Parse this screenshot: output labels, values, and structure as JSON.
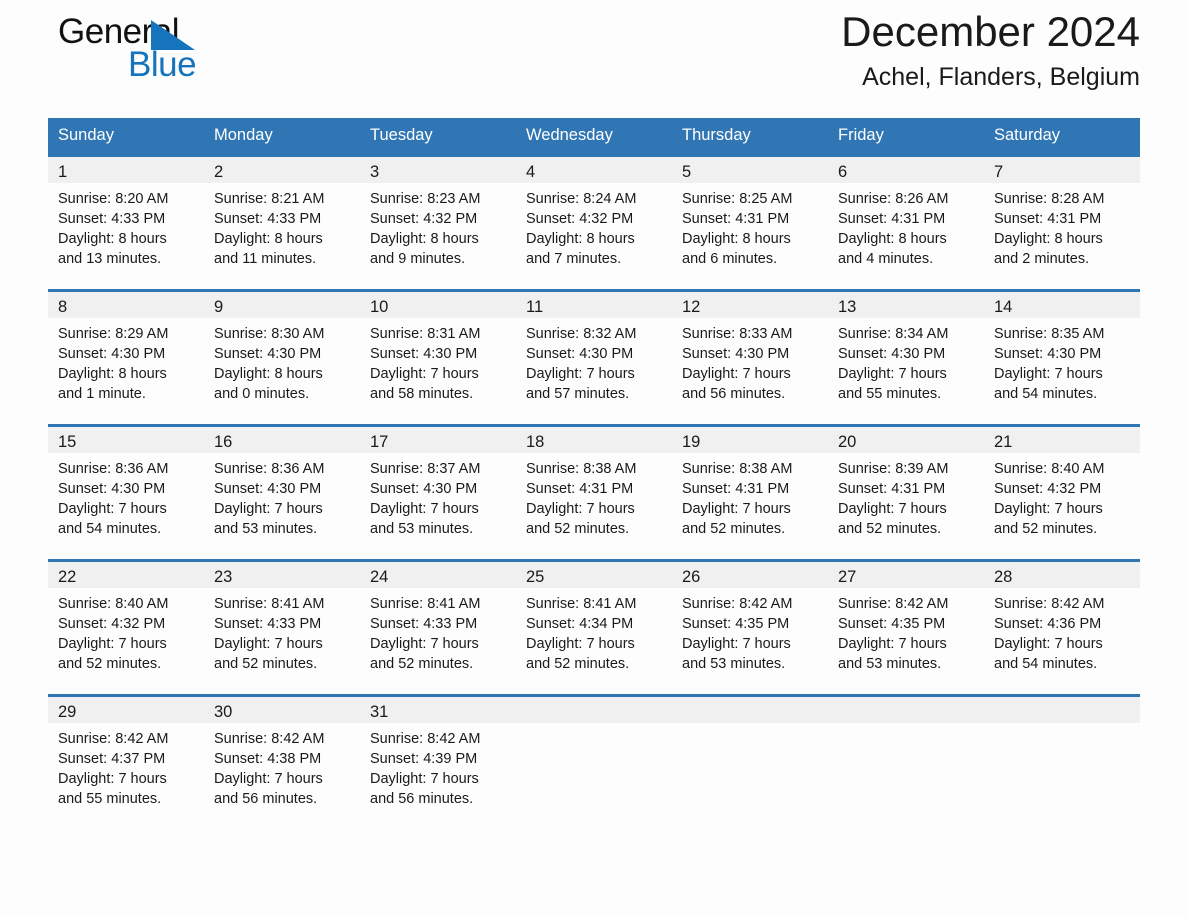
{
  "brand": {
    "name_part1": "General",
    "name_part2": "Blue",
    "triangle_color": "#1574bb",
    "text_color": "#111111"
  },
  "header": {
    "title": "December 2024",
    "subtitle": "Achel, Flanders, Belgium"
  },
  "theme": {
    "accent": "#3075b4",
    "band": "#f0f0f0",
    "page_bg": "#fdfdfd",
    "text": "#1a1a1a"
  },
  "calendar": {
    "weekday_headers": [
      "Sunday",
      "Monday",
      "Tuesday",
      "Wednesday",
      "Thursday",
      "Friday",
      "Saturday"
    ],
    "weeks": [
      [
        {
          "day": "1",
          "sunrise": "Sunrise: 8:20 AM",
          "sunset": "Sunset: 4:33 PM",
          "daylight_line1": "Daylight: 8 hours",
          "daylight_line2": "and 13 minutes."
        },
        {
          "day": "2",
          "sunrise": "Sunrise: 8:21 AM",
          "sunset": "Sunset: 4:33 PM",
          "daylight_line1": "Daylight: 8 hours",
          "daylight_line2": "and 11 minutes."
        },
        {
          "day": "3",
          "sunrise": "Sunrise: 8:23 AM",
          "sunset": "Sunset: 4:32 PM",
          "daylight_line1": "Daylight: 8 hours",
          "daylight_line2": "and 9 minutes."
        },
        {
          "day": "4",
          "sunrise": "Sunrise: 8:24 AM",
          "sunset": "Sunset: 4:32 PM",
          "daylight_line1": "Daylight: 8 hours",
          "daylight_line2": "and 7 minutes."
        },
        {
          "day": "5",
          "sunrise": "Sunrise: 8:25 AM",
          "sunset": "Sunset: 4:31 PM",
          "daylight_line1": "Daylight: 8 hours",
          "daylight_line2": "and 6 minutes."
        },
        {
          "day": "6",
          "sunrise": "Sunrise: 8:26 AM",
          "sunset": "Sunset: 4:31 PM",
          "daylight_line1": "Daylight: 8 hours",
          "daylight_line2": "and 4 minutes."
        },
        {
          "day": "7",
          "sunrise": "Sunrise: 8:28 AM",
          "sunset": "Sunset: 4:31 PM",
          "daylight_line1": "Daylight: 8 hours",
          "daylight_line2": "and 2 minutes."
        }
      ],
      [
        {
          "day": "8",
          "sunrise": "Sunrise: 8:29 AM",
          "sunset": "Sunset: 4:30 PM",
          "daylight_line1": "Daylight: 8 hours",
          "daylight_line2": "and 1 minute."
        },
        {
          "day": "9",
          "sunrise": "Sunrise: 8:30 AM",
          "sunset": "Sunset: 4:30 PM",
          "daylight_line1": "Daylight: 8 hours",
          "daylight_line2": "and 0 minutes."
        },
        {
          "day": "10",
          "sunrise": "Sunrise: 8:31 AM",
          "sunset": "Sunset: 4:30 PM",
          "daylight_line1": "Daylight: 7 hours",
          "daylight_line2": "and 58 minutes."
        },
        {
          "day": "11",
          "sunrise": "Sunrise: 8:32 AM",
          "sunset": "Sunset: 4:30 PM",
          "daylight_line1": "Daylight: 7 hours",
          "daylight_line2": "and 57 minutes."
        },
        {
          "day": "12",
          "sunrise": "Sunrise: 8:33 AM",
          "sunset": "Sunset: 4:30 PM",
          "daylight_line1": "Daylight: 7 hours",
          "daylight_line2": "and 56 minutes."
        },
        {
          "day": "13",
          "sunrise": "Sunrise: 8:34 AM",
          "sunset": "Sunset: 4:30 PM",
          "daylight_line1": "Daylight: 7 hours",
          "daylight_line2": "and 55 minutes."
        },
        {
          "day": "14",
          "sunrise": "Sunrise: 8:35 AM",
          "sunset": "Sunset: 4:30 PM",
          "daylight_line1": "Daylight: 7 hours",
          "daylight_line2": "and 54 minutes."
        }
      ],
      [
        {
          "day": "15",
          "sunrise": "Sunrise: 8:36 AM",
          "sunset": "Sunset: 4:30 PM",
          "daylight_line1": "Daylight: 7 hours",
          "daylight_line2": "and 54 minutes."
        },
        {
          "day": "16",
          "sunrise": "Sunrise: 8:36 AM",
          "sunset": "Sunset: 4:30 PM",
          "daylight_line1": "Daylight: 7 hours",
          "daylight_line2": "and 53 minutes."
        },
        {
          "day": "17",
          "sunrise": "Sunrise: 8:37 AM",
          "sunset": "Sunset: 4:30 PM",
          "daylight_line1": "Daylight: 7 hours",
          "daylight_line2": "and 53 minutes."
        },
        {
          "day": "18",
          "sunrise": "Sunrise: 8:38 AM",
          "sunset": "Sunset: 4:31 PM",
          "daylight_line1": "Daylight: 7 hours",
          "daylight_line2": "and 52 minutes."
        },
        {
          "day": "19",
          "sunrise": "Sunrise: 8:38 AM",
          "sunset": "Sunset: 4:31 PM",
          "daylight_line1": "Daylight: 7 hours",
          "daylight_line2": "and 52 minutes."
        },
        {
          "day": "20",
          "sunrise": "Sunrise: 8:39 AM",
          "sunset": "Sunset: 4:31 PM",
          "daylight_line1": "Daylight: 7 hours",
          "daylight_line2": "and 52 minutes."
        },
        {
          "day": "21",
          "sunrise": "Sunrise: 8:40 AM",
          "sunset": "Sunset: 4:32 PM",
          "daylight_line1": "Daylight: 7 hours",
          "daylight_line2": "and 52 minutes."
        }
      ],
      [
        {
          "day": "22",
          "sunrise": "Sunrise: 8:40 AM",
          "sunset": "Sunset: 4:32 PM",
          "daylight_line1": "Daylight: 7 hours",
          "daylight_line2": "and 52 minutes."
        },
        {
          "day": "23",
          "sunrise": "Sunrise: 8:41 AM",
          "sunset": "Sunset: 4:33 PM",
          "daylight_line1": "Daylight: 7 hours",
          "daylight_line2": "and 52 minutes."
        },
        {
          "day": "24",
          "sunrise": "Sunrise: 8:41 AM",
          "sunset": "Sunset: 4:33 PM",
          "daylight_line1": "Daylight: 7 hours",
          "daylight_line2": "and 52 minutes."
        },
        {
          "day": "25",
          "sunrise": "Sunrise: 8:41 AM",
          "sunset": "Sunset: 4:34 PM",
          "daylight_line1": "Daylight: 7 hours",
          "daylight_line2": "and 52 minutes."
        },
        {
          "day": "26",
          "sunrise": "Sunrise: 8:42 AM",
          "sunset": "Sunset: 4:35 PM",
          "daylight_line1": "Daylight: 7 hours",
          "daylight_line2": "and 53 minutes."
        },
        {
          "day": "27",
          "sunrise": "Sunrise: 8:42 AM",
          "sunset": "Sunset: 4:35 PM",
          "daylight_line1": "Daylight: 7 hours",
          "daylight_line2": "and 53 minutes."
        },
        {
          "day": "28",
          "sunrise": "Sunrise: 8:42 AM",
          "sunset": "Sunset: 4:36 PM",
          "daylight_line1": "Daylight: 7 hours",
          "daylight_line2": "and 54 minutes."
        }
      ],
      [
        {
          "day": "29",
          "sunrise": "Sunrise: 8:42 AM",
          "sunset": "Sunset: 4:37 PM",
          "daylight_line1": "Daylight: 7 hours",
          "daylight_line2": "and 55 minutes."
        },
        {
          "day": "30",
          "sunrise": "Sunrise: 8:42 AM",
          "sunset": "Sunset: 4:38 PM",
          "daylight_line1": "Daylight: 7 hours",
          "daylight_line2": "and 56 minutes."
        },
        {
          "day": "31",
          "sunrise": "Sunrise: 8:42 AM",
          "sunset": "Sunset: 4:39 PM",
          "daylight_line1": "Daylight: 7 hours",
          "daylight_line2": "and 56 minutes."
        },
        {
          "day": "",
          "sunrise": "",
          "sunset": "",
          "daylight_line1": "",
          "daylight_line2": ""
        },
        {
          "day": "",
          "sunrise": "",
          "sunset": "",
          "daylight_line1": "",
          "daylight_line2": ""
        },
        {
          "day": "",
          "sunrise": "",
          "sunset": "",
          "daylight_line1": "",
          "daylight_line2": ""
        },
        {
          "day": "",
          "sunrise": "",
          "sunset": "",
          "daylight_line1": "",
          "daylight_line2": ""
        }
      ]
    ]
  }
}
